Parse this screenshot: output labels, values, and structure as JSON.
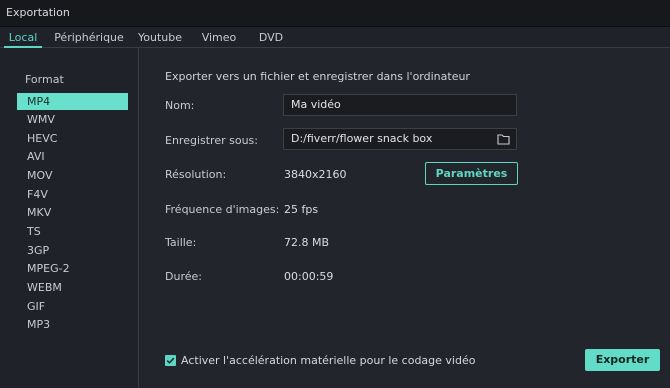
{
  "window": {
    "title": "Exportation"
  },
  "tabs": [
    {
      "label": "Local",
      "active": true
    },
    {
      "label": "Périphérique"
    },
    {
      "label": "Youtube"
    },
    {
      "label": "Vimeo"
    },
    {
      "label": "DVD"
    }
  ],
  "sidebar": {
    "heading": "Format",
    "formats": [
      "MP4",
      "WMV",
      "HEVC",
      "AVI",
      "MOV",
      "F4V",
      "MKV",
      "TS",
      "3GP",
      "MPEG-2",
      "WEBM",
      "GIF",
      "MP3"
    ],
    "selected": "MP4"
  },
  "main": {
    "section_title": "Exporter vers un fichier et enregistrer dans l'ordinateur",
    "name_label": "Nom:",
    "name_value": "Ma vidéo",
    "save_label": "Enregistrer sous:",
    "save_value": "D:/fiverr/flower snack box",
    "resolution_label": "Résolution:",
    "resolution_value": "3840x2160",
    "settings_button": "Paramètres",
    "fps_label": "Fréquence d'images:",
    "fps_value": "25 fps",
    "size_label": "Taille:",
    "size_value": "72.8 MB",
    "duration_label": "Durée:",
    "duration_value": "00:00:59",
    "hw_accel_label": "Activer l'accélération matérielle pour le codage vidéo",
    "hw_accel_checked": true,
    "export_button": "Exporter"
  },
  "colors": {
    "accent": "#5fd6c3",
    "background": "#22252b",
    "titlebar": "#16181c"
  }
}
